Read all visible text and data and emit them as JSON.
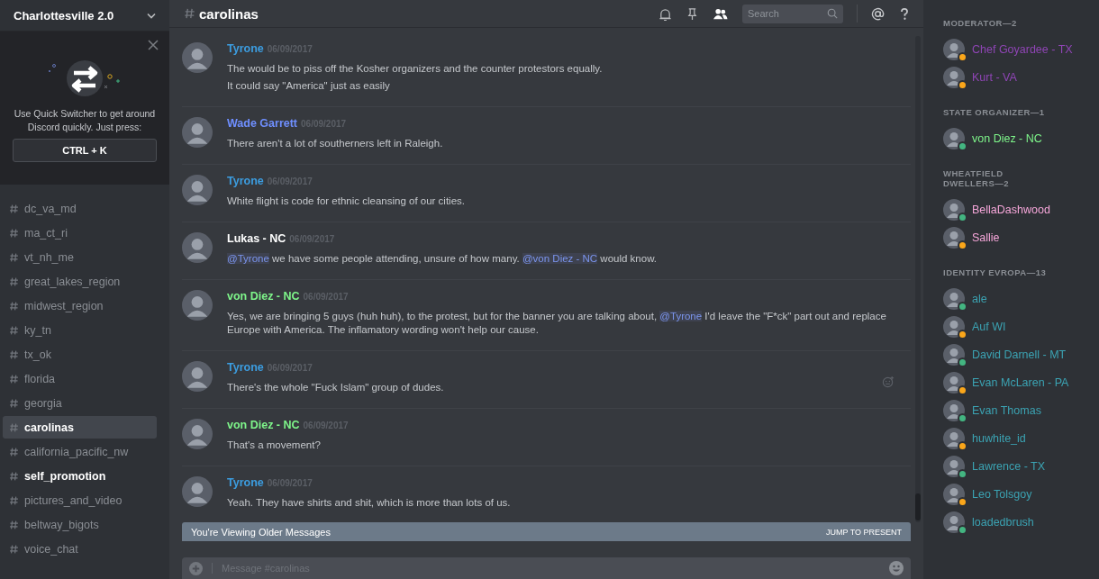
{
  "server": {
    "name": "Charlottesville 2.0"
  },
  "quick_switcher": {
    "text": "Use Quick Switcher to get around Discord quickly. Just press:",
    "shortcut": "CTRL + K"
  },
  "channels": [
    {
      "name": "dc_va_md",
      "selected": false,
      "unread": false
    },
    {
      "name": "ma_ct_ri",
      "selected": false,
      "unread": false
    },
    {
      "name": "vt_nh_me",
      "selected": false,
      "unread": false
    },
    {
      "name": "great_lakes_region",
      "selected": false,
      "unread": false
    },
    {
      "name": "midwest_region",
      "selected": false,
      "unread": false
    },
    {
      "name": "ky_tn",
      "selected": false,
      "unread": false
    },
    {
      "name": "tx_ok",
      "selected": false,
      "unread": false
    },
    {
      "name": "florida",
      "selected": false,
      "unread": false
    },
    {
      "name": "georgia",
      "selected": false,
      "unread": false
    },
    {
      "name": "carolinas",
      "selected": true,
      "unread": false
    },
    {
      "name": "california_pacific_nw",
      "selected": false,
      "unread": false
    },
    {
      "name": "self_promotion",
      "selected": false,
      "unread": true
    },
    {
      "name": "pictures_and_video",
      "selected": false,
      "unread": false
    },
    {
      "name": "beltway_bigots",
      "selected": false,
      "unread": false
    },
    {
      "name": "voice_chat",
      "selected": false,
      "unread": false
    }
  ],
  "header": {
    "channel": "carolinas",
    "search_placeholder": "Search",
    "members_shown": true
  },
  "messages": [
    {
      "author": "Tyrone",
      "color": "#3c9de0",
      "time": "06/09/2017",
      "hovered": false,
      "lines": [
        [
          {
            "text": "The would be to piss off the Kosher organizers and the counter protestors equally."
          }
        ],
        [
          {
            "text": "It could say \"America\" just as easily"
          }
        ]
      ]
    },
    {
      "author": "Wade Garrett",
      "color": "#6f8fff",
      "time": "06/09/2017",
      "hovered": false,
      "lines": [
        [
          {
            "text": "There aren't a lot of southerners left in Raleigh."
          }
        ]
      ]
    },
    {
      "author": "Tyrone",
      "color": "#3c9de0",
      "time": "06/09/2017",
      "hovered": false,
      "lines": [
        [
          {
            "text": "White flight is code for ethnic cleansing of our cities."
          }
        ]
      ]
    },
    {
      "author": "Lukas - NC",
      "color": "#ffffff",
      "time": "06/09/2017",
      "hovered": false,
      "lines": [
        [
          {
            "kind": "mention",
            "text": "@Tyrone"
          },
          {
            "text": " we have some people attending, unsure of how many. "
          },
          {
            "kind": "mention",
            "text": "@von Diez - NC"
          },
          {
            "text": " would know."
          }
        ]
      ]
    },
    {
      "author": "von Diez - NC",
      "color": "#7ef58a",
      "time": "06/09/2017",
      "hovered": false,
      "lines": [
        [
          {
            "text": "Yes, we are bringing 5 guys (huh huh), to the protest, but for the banner you are talking about, "
          },
          {
            "kind": "mention",
            "text": "@Tyrone"
          },
          {
            "text": "  I'd leave the \"F*ck\" part out and replace Europe with America. The inflamatory wording won't help our cause."
          }
        ]
      ]
    },
    {
      "author": "Tyrone",
      "color": "#3c9de0",
      "time": "06/09/2017",
      "hovered": true,
      "lines": [
        [
          {
            "text": "There's the whole \"Fuck Islam\" group of dudes."
          }
        ]
      ]
    },
    {
      "author": "von Diez - NC",
      "color": "#7ef58a",
      "time": "06/09/2017",
      "hovered": false,
      "lines": [
        [
          {
            "text": "That's a movement?"
          }
        ]
      ]
    },
    {
      "author": "Tyrone",
      "color": "#3c9de0",
      "time": "06/09/2017",
      "hovered": false,
      "lines": [
        [
          {
            "text": "Yeah. They have shirts and shit, which is more than lots of us."
          }
        ]
      ]
    }
  ],
  "older_bar": {
    "text": "You're Viewing Older Messages",
    "action": "JUMP TO PRESENT"
  },
  "composer": {
    "placeholder": "Message #carolinas"
  },
  "member_groups": [
    {
      "title": "MODERATOR—2",
      "color": "#8f45b5",
      "members": [
        {
          "name": "Chef Goyardee - TX",
          "color": "#faa61a"
        },
        {
          "name": "Kurt - VA",
          "color": "#faa61a"
        }
      ]
    },
    {
      "title": "STATE ORGANIZER—1",
      "color": "#7ef58a",
      "members": [
        {
          "name": "von Diez - NC",
          "color": "#43b581"
        }
      ]
    },
    {
      "title": "WHEATFIELD DWELLERS—2",
      "color": "#f5a6d9",
      "members": [
        {
          "name": "BellaDashwood",
          "color": "#43b581"
        },
        {
          "name": "Sallie",
          "color": "#faa61a"
        }
      ]
    },
    {
      "title": "IDENTITY EVROPA—13",
      "color": "#3ba3b3",
      "members": [
        {
          "name": "ale",
          "color": "#43b581"
        },
        {
          "name": "Auf WI",
          "color": "#faa61a"
        },
        {
          "name": "David Darnell - MT",
          "color": "#43b581"
        },
        {
          "name": "Evan McLaren - PA",
          "color": "#faa61a"
        },
        {
          "name": "Evan Thomas",
          "color": "#43b581"
        },
        {
          "name": "huwhite_id",
          "color": "#faa61a"
        },
        {
          "name": "Lawrence - TX",
          "color": "#43b581"
        },
        {
          "name": "Leo Tolsgoy",
          "color": "#faa61a"
        },
        {
          "name": "loadedbrush",
          "color": "#43b581"
        }
      ]
    }
  ]
}
